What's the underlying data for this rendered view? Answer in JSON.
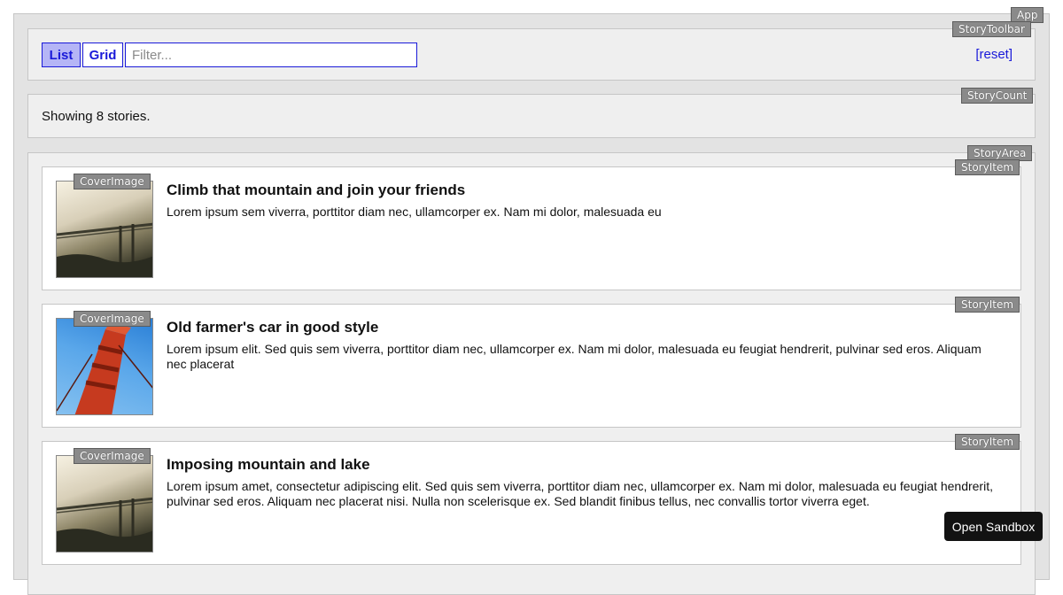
{
  "labels": {
    "app": "App",
    "story_toolbar": "StoryToolbar",
    "story_count": "StoryCount",
    "story_area": "StoryArea",
    "story_item": "StoryItem",
    "cover_image": "CoverImage"
  },
  "toolbar": {
    "list_label": "List",
    "grid_label": "Grid",
    "active_view": "List",
    "filter_value": "",
    "filter_placeholder": "Filter...",
    "reset_label": "[reset]"
  },
  "count": {
    "text": "Showing 8 stories."
  },
  "stories": [
    {
      "title": "Climb that mountain and join your friends",
      "body": "Lorem ipsum sem viverra, porttitor diam nec, ullamcorper ex. Nam mi dolor, malesuada eu",
      "cover": "misty-bridge-image"
    },
    {
      "title": "Old farmer's car in good style",
      "body": "Lorem ipsum elit. Sed quis sem viverra, porttitor diam nec, ullamcorper ex. Nam mi dolor, malesuada eu feugiat hendrerit, pulvinar sed eros. Aliquam nec placerat",
      "cover": "red-bridge-tower-image"
    },
    {
      "title": "Imposing mountain and lake",
      "body": "Lorem ipsum amet, consectetur adipiscing elit. Sed quis sem viverra, porttitor diam nec, ullamcorper ex. Nam mi dolor, malesuada eu feugiat hendrerit, pulvinar sed eros. Aliquam nec placerat nisi. Nulla non scelerisque ex. Sed blandit finibus tellus, nec convallis tortor viverra eget.",
      "cover": "misty-bridge-image"
    }
  ],
  "sandbox": {
    "label": "Open Sandbox"
  },
  "colors": {
    "link": "#1a1ad9",
    "active_button": "#b5b5f6",
    "panel": "#efefef",
    "app_bg": "#e3e3e3",
    "debug_tag": "#8a8a8a",
    "sandbox_button": "#121212"
  }
}
